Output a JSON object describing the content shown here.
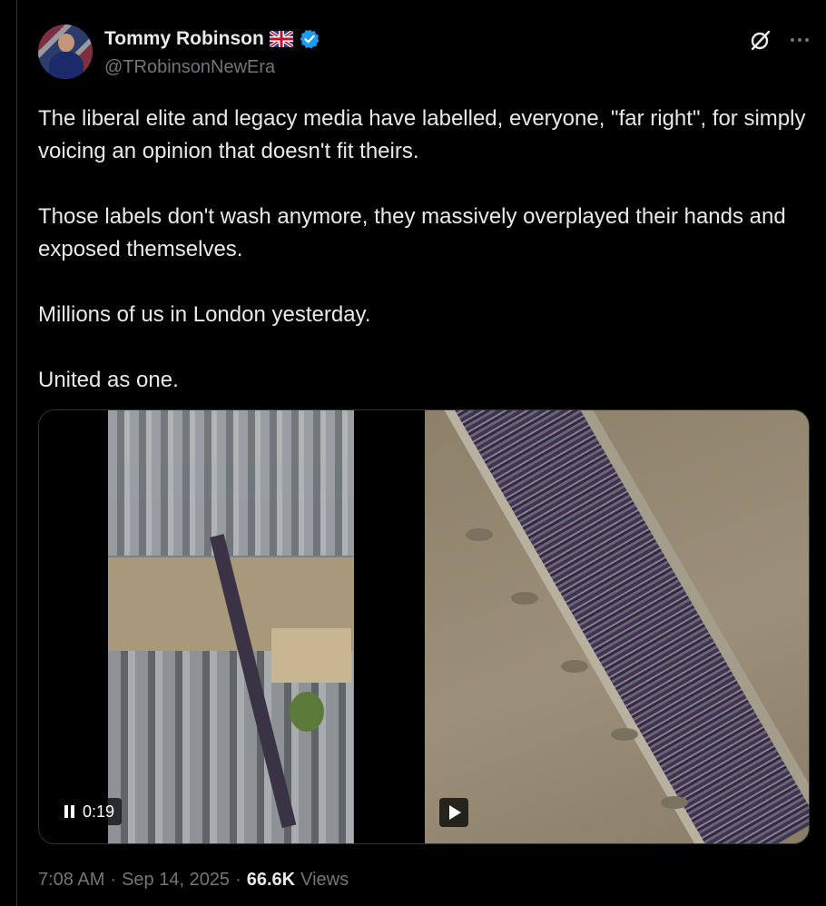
{
  "author": {
    "name": "Tommy Robinson",
    "handle": "@TRobinsonNewEra",
    "flag_icon": "uk-flag-icon",
    "verified_icon": "verified-badge-icon",
    "verified_color": "#1d9bf0"
  },
  "post": {
    "paragraphs": [
      "The liberal elite and legacy media have labelled, everyone, \"far right\", for simply voicing an opinion that doesn't fit theirs.",
      "Those labels don't wash anymore, they massively overplayed their hands and exposed themselves.",
      "Millions of us in London yesterday.",
      "United as one."
    ]
  },
  "media": {
    "video1": {
      "timer": "0:19",
      "state_icon": "pause-icon"
    },
    "video2": {
      "state_icon": "play-icon"
    }
  },
  "meta": {
    "time": "7:08 AM",
    "sep1": "·",
    "date": "Sep 14, 2025",
    "sep2": "·",
    "views_count": "66.6K",
    "views_label": "Views"
  },
  "colors": {
    "background": "#000000",
    "text": "#e7e9ea",
    "secondary": "#71767b"
  }
}
